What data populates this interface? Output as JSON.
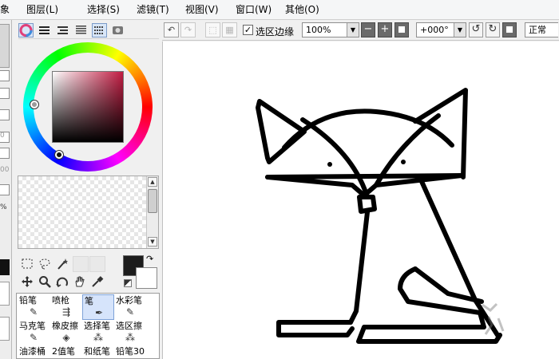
{
  "menu": [
    "象",
    "图层(L)",
    "选择(S)",
    "滤镜(T)",
    "视图(V)",
    "窗口(W)",
    "其他(O)"
  ],
  "left_strip": {
    "values": [
      "0",
      "00",
      "%"
    ]
  },
  "color_panel": {
    "mode_icons": [
      "color-wheel-icon",
      "rgb-slider-icon",
      "hsv-slider-icon",
      "intermediate-icon",
      "swatch-grid-icon",
      "scratchpad-icon"
    ],
    "hue_color": "#c21d43",
    "foreground_color": "#1c1c1c",
    "background_color": "#ffffff"
  },
  "tools": [
    "rect-select-icon",
    "lasso-icon",
    "magic-wand-icon",
    "move-icon",
    "zoom-icon",
    "rotate-icon",
    "hand-icon",
    "eyedropper-icon"
  ],
  "brushes": [
    {
      "label": "铅笔",
      "icon": "✎"
    },
    {
      "label": "喷枪",
      "icon": "⇶"
    },
    {
      "label": "笔",
      "icon": "✒",
      "selected": true
    },
    {
      "label": "水彩笔",
      "icon": "✎"
    },
    {
      "label": "马克笔",
      "icon": "✎"
    },
    {
      "label": "橡皮擦",
      "icon": "◈"
    },
    {
      "label": "选择笔",
      "icon": "⁂"
    },
    {
      "label": "选区擦",
      "icon": "⁂"
    },
    {
      "label": "油漆桶",
      "icon": "◆"
    },
    {
      "label": "2值笔",
      "icon": "✎"
    },
    {
      "label": "和纸笔",
      "icon": "✎"
    },
    {
      "label": "铅笔30",
      "icon": "✎"
    }
  ],
  "toolbar": {
    "selection_edge_label": "选区边缘",
    "selection_edge_checked": "✓",
    "zoom": "100%",
    "rotation": "+000°",
    "blend_mode": "正常"
  }
}
